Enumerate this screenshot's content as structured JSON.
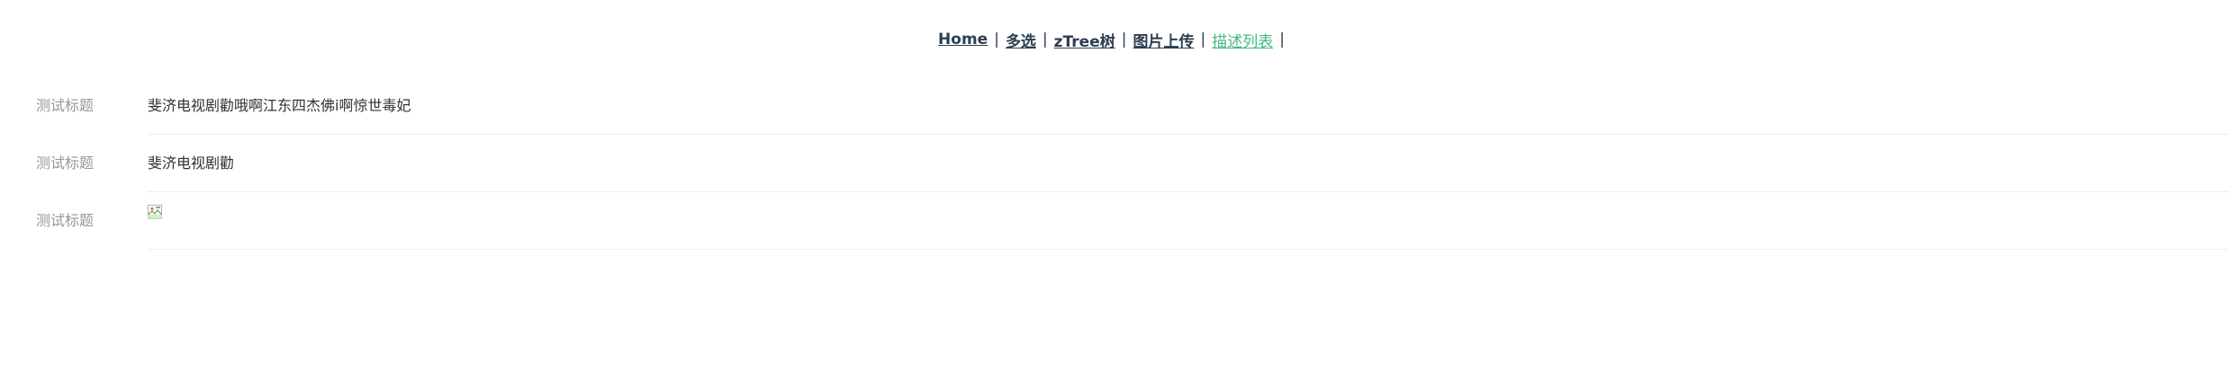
{
  "nav": {
    "links": [
      {
        "label": "Home"
      },
      {
        "label": "多选"
      },
      {
        "label": "zTree树"
      },
      {
        "label": "图片上传"
      },
      {
        "label": "描述列表"
      }
    ],
    "separator": "|",
    "active_color": "#42b983"
  },
  "descriptions": [
    {
      "title": "测试标题",
      "content": "斐济电视剧勸哦啊江东四杰佛i啊惊世毒妃"
    },
    {
      "title": "测试标题",
      "content": "斐济电视剧勸"
    },
    {
      "title": "测试标题",
      "image_icon": "broken-image-icon"
    }
  ]
}
